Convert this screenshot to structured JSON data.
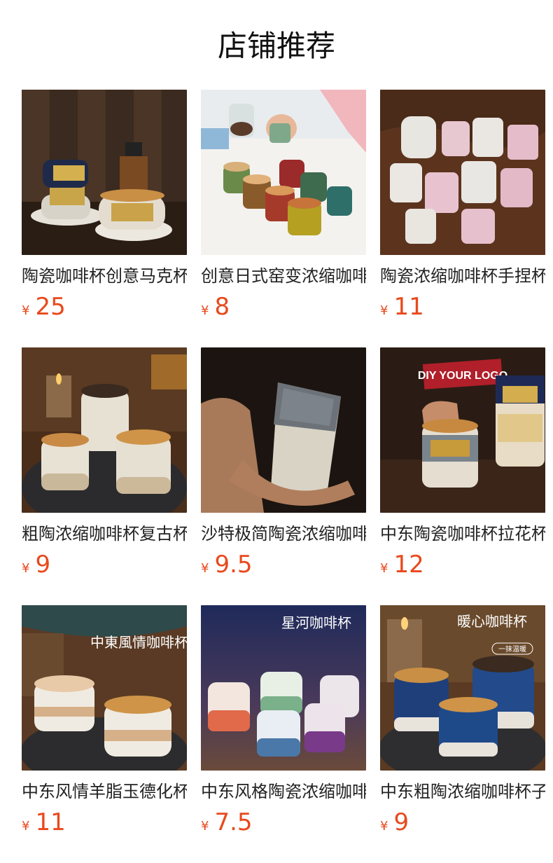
{
  "header": {
    "title": "店铺推荐"
  },
  "products": [
    {
      "name": "陶瓷咖啡杯创意马克杯",
      "currency": "¥",
      "price": "25",
      "image": "gold-plaque-stacked-mugs-photo",
      "overlay": {}
    },
    {
      "name": "创意日式窑变浓缩咖啡杯",
      "currency": "¥",
      "price": "8",
      "image": "colorful-glaze-cups-photo",
      "overlay": {}
    },
    {
      "name": "陶瓷浓缩咖啡杯手捏杯",
      "currency": "¥",
      "price": "11",
      "image": "white-pink-textured-cups-photo",
      "overlay": {}
    },
    {
      "name": "粗陶浓缩咖啡杯复古杯",
      "currency": "¥",
      "price": "9",
      "image": "cream-stoneware-cups-photo",
      "overlay": {}
    },
    {
      "name": "沙特极简陶瓷浓缩咖啡杯",
      "currency": "¥",
      "price": "9.5",
      "image": "grey-embossed-cup-in-hand-photo",
      "overlay": {}
    },
    {
      "name": "中东陶瓷咖啡杯拉花杯",
      "currency": "¥",
      "price": "12",
      "image": "diy-logo-cups-photo",
      "overlay": {
        "badge": "DIY YOUR LOGO"
      }
    },
    {
      "name": "中东风情羊脂玉德化杯",
      "currency": "¥",
      "price": "11",
      "image": "middle-east-style-cups-poster",
      "overlay": {
        "title": "中東風情咖啡杯"
      }
    },
    {
      "name": "中东风格陶瓷浓缩咖啡杯",
      "currency": "¥",
      "price": "7.5",
      "image": "galaxy-gradient-cups-poster",
      "overlay": {
        "title": "星河咖啡杯"
      }
    },
    {
      "name": "中东粗陶浓缩咖啡杯子",
      "currency": "¥",
      "price": "9",
      "image": "blue-glaze-cups-poster",
      "overlay": {
        "title": "暖心咖啡杯",
        "tag": "一抹温暖"
      }
    }
  ],
  "colors": {
    "price": "#e8491d",
    "title": "#111111"
  }
}
